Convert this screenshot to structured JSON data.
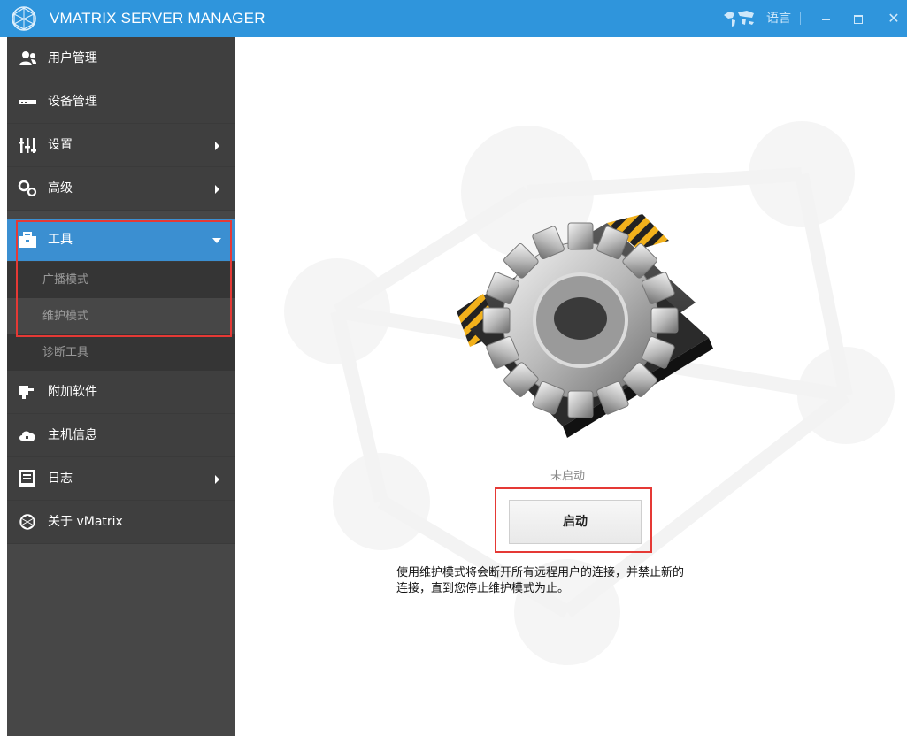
{
  "window": {
    "title": "VMATRIX SERVER MANAGER",
    "language_label": "语言",
    "minimize_icon": "minimize-icon",
    "maximize_icon": "maximize-icon",
    "close_icon": "close-icon"
  },
  "sidebar": {
    "items": [
      {
        "label": "用户管理",
        "icon": "users-icon"
      },
      {
        "label": "设备管理",
        "icon": "device-icon"
      },
      {
        "label": "设置",
        "icon": "sliders-icon"
      },
      {
        "label": "高级",
        "icon": "gears-icon"
      },
      {
        "label": "工具",
        "icon": "toolbox-icon"
      },
      {
        "label": "附加软件",
        "icon": "plugin-icon"
      },
      {
        "label": "主机信息",
        "icon": "cloud-icon"
      },
      {
        "label": "日志",
        "icon": "log-icon"
      },
      {
        "label": "关于 vMatrix",
        "icon": "logo-icon"
      }
    ],
    "tools_submenu": [
      "广播模式",
      "维护模式",
      "诊断工具"
    ]
  },
  "main": {
    "status_text": "未启动",
    "start_button_label": "启动",
    "description_line1": "使用维护模式将会断开所有远程用户的连接，并禁止新的",
    "description_line2": "连接，直到您停止维护模式为止。"
  },
  "colors": {
    "titlebar": "#2f95dc",
    "sidebar": "#474747",
    "active_item": "#3b8fd1",
    "highlight": "#e53935"
  }
}
